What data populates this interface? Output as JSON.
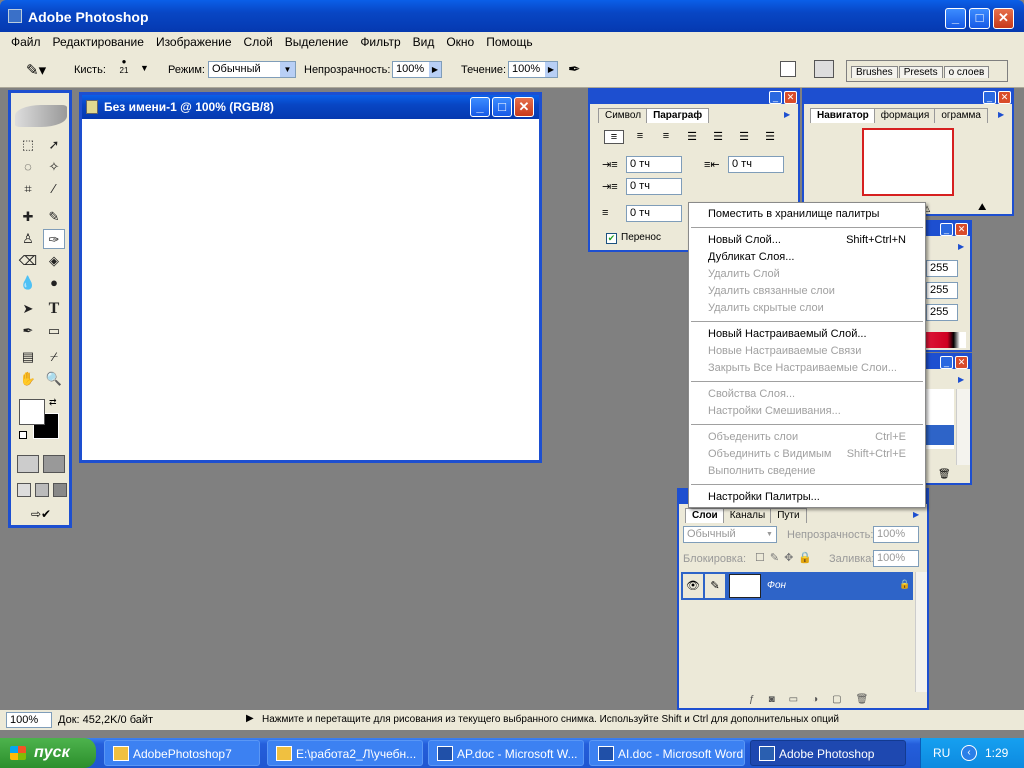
{
  "app": {
    "title": "Adobe Photoshop"
  },
  "menubar": [
    "Файл",
    "Редактирование",
    "Изображение",
    "Слой",
    "Выделение",
    "Фильтр",
    "Вид",
    "Окно",
    "Помощь"
  ],
  "options": {
    "brush_label": "Кисть:",
    "brush_size": "21",
    "mode_label": "Режим:",
    "mode_value": "Обычный",
    "opacity_label": "Непрозрачность:",
    "opacity_value": "100%",
    "flow_label": "Течение:",
    "flow_value": "100%",
    "well_tabs": [
      "Brushes",
      "Presets",
      "о слоев"
    ]
  },
  "document": {
    "title": "Без имени-1 @ 100% (RGB/8)"
  },
  "paragraph_panel": {
    "tabs": [
      "Символ",
      "Параграф"
    ],
    "active_tab": "Параграф",
    "indent_left": "0 тч",
    "indent_right": "0 тч",
    "indent_first": "0 тч",
    "space_after": "0 тч",
    "hyphenate_label": "Перенос"
  },
  "navigator_panel": {
    "tabs": [
      "Навигатор",
      "формация",
      "ограмма"
    ],
    "active_tab": "Навигатор"
  },
  "color_panel": {
    "values": [
      "255",
      "255",
      "255"
    ]
  },
  "layers_panel": {
    "tabs": [
      "Слои",
      "Каналы",
      "Пути"
    ],
    "active_tab": "Слои",
    "blend_mode": "Обычный",
    "opacity_label": "Непрозрачность:",
    "opacity_value": "100%",
    "lock_label": "Блокировка:",
    "fill_label": "Заливка:",
    "fill_value": "100%",
    "layer_name": "Фон"
  },
  "context_menu": {
    "groups": [
      [
        {
          "label": "Поместить в хранилище палитры",
          "shortcut": "",
          "enabled": true
        }
      ],
      [
        {
          "label": "Новый Слой...",
          "shortcut": "Shift+Ctrl+N",
          "enabled": true
        },
        {
          "label": "Дубликат Слоя...",
          "shortcut": "",
          "enabled": true
        },
        {
          "label": "Удалить Слой",
          "shortcut": "",
          "enabled": false
        },
        {
          "label": "Удалить связанные слои",
          "shortcut": "",
          "enabled": false
        },
        {
          "label": "Удалить скрытые слои",
          "shortcut": "",
          "enabled": false
        }
      ],
      [
        {
          "label": "Новый Настраиваемый Слой...",
          "shortcut": "",
          "enabled": true
        },
        {
          "label": "Новые Настраиваемые Связи",
          "shortcut": "",
          "enabled": false
        },
        {
          "label": "Закрыть Все Настраиваемые Слои...",
          "shortcut": "",
          "enabled": false
        }
      ],
      [
        {
          "label": "Свойства Слоя...",
          "shortcut": "",
          "enabled": false
        },
        {
          "label": "Настройки Смешивания...",
          "shortcut": "",
          "enabled": false
        }
      ],
      [
        {
          "label": "Объеденить слои",
          "shortcut": "Ctrl+E",
          "enabled": false
        },
        {
          "label": "Объединить с Видимым",
          "shortcut": "Shift+Ctrl+E",
          "enabled": false
        },
        {
          "label": "Выполнить сведение",
          "shortcut": "",
          "enabled": false
        }
      ],
      [
        {
          "label": "Настройки Палитры...",
          "shortcut": "",
          "enabled": true
        }
      ]
    ]
  },
  "status": {
    "zoom": "100%",
    "doc": "Док: 452,2K/0 байт",
    "hint": "Нажмите и перетащите для рисования из текущего выбранного снимка. Используйте Shift и Ctrl для дополнительных опций"
  },
  "taskbar": {
    "start": "пуск",
    "items": [
      "AdobePhotoshop7",
      "E:\\работа2_Л\\учебн...",
      "AP.doc - Microsoft W...",
      "AI.doc - Microsoft Word",
      "Adobe Photoshop"
    ],
    "lang": "RU",
    "time": "1:29"
  }
}
